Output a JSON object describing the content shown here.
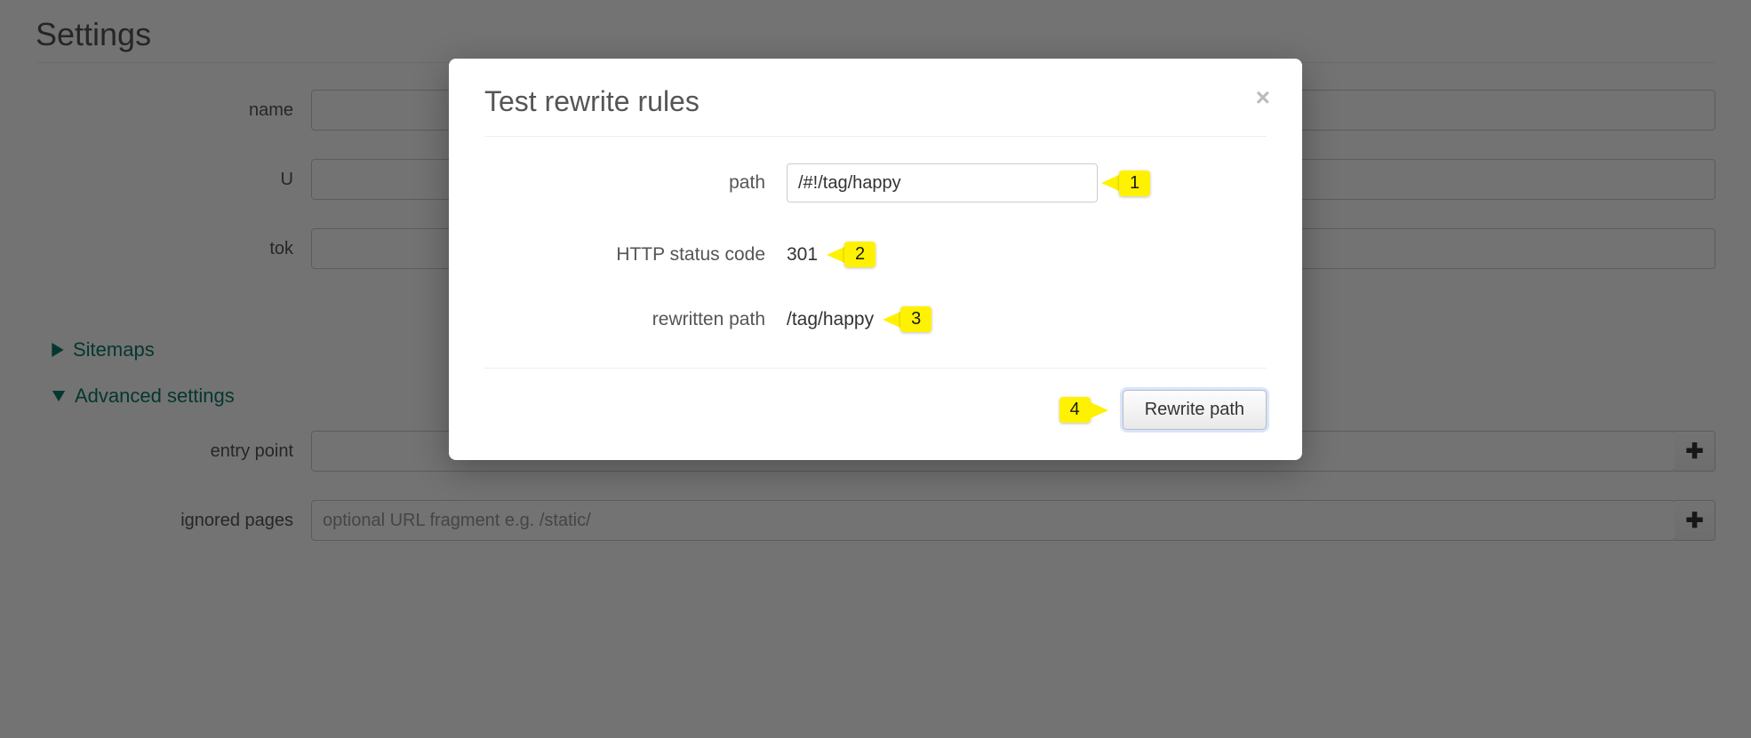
{
  "page": {
    "title": "Settings",
    "fields": {
      "name_label": "name",
      "u_label": "U",
      "tok_label": "tok"
    },
    "sections": {
      "sitemaps": "Sitemaps",
      "advanced": "Advanced settings"
    },
    "adv_fields": {
      "entry_point_label": "entry point",
      "ignored_pages_label": "ignored pages",
      "ignored_placeholder": "optional URL fragment e.g. /static/"
    }
  },
  "modal": {
    "title": "Test rewrite rules",
    "labels": {
      "path": "path",
      "status": "HTTP status code",
      "rewritten": "rewritten path"
    },
    "values": {
      "path_input": "/#!/tag/happy",
      "status_code": "301",
      "rewritten_path": "/tag/happy"
    },
    "button": "Rewrite path"
  },
  "annotations": {
    "one": "1",
    "two": "2",
    "three": "3",
    "four": "4"
  }
}
